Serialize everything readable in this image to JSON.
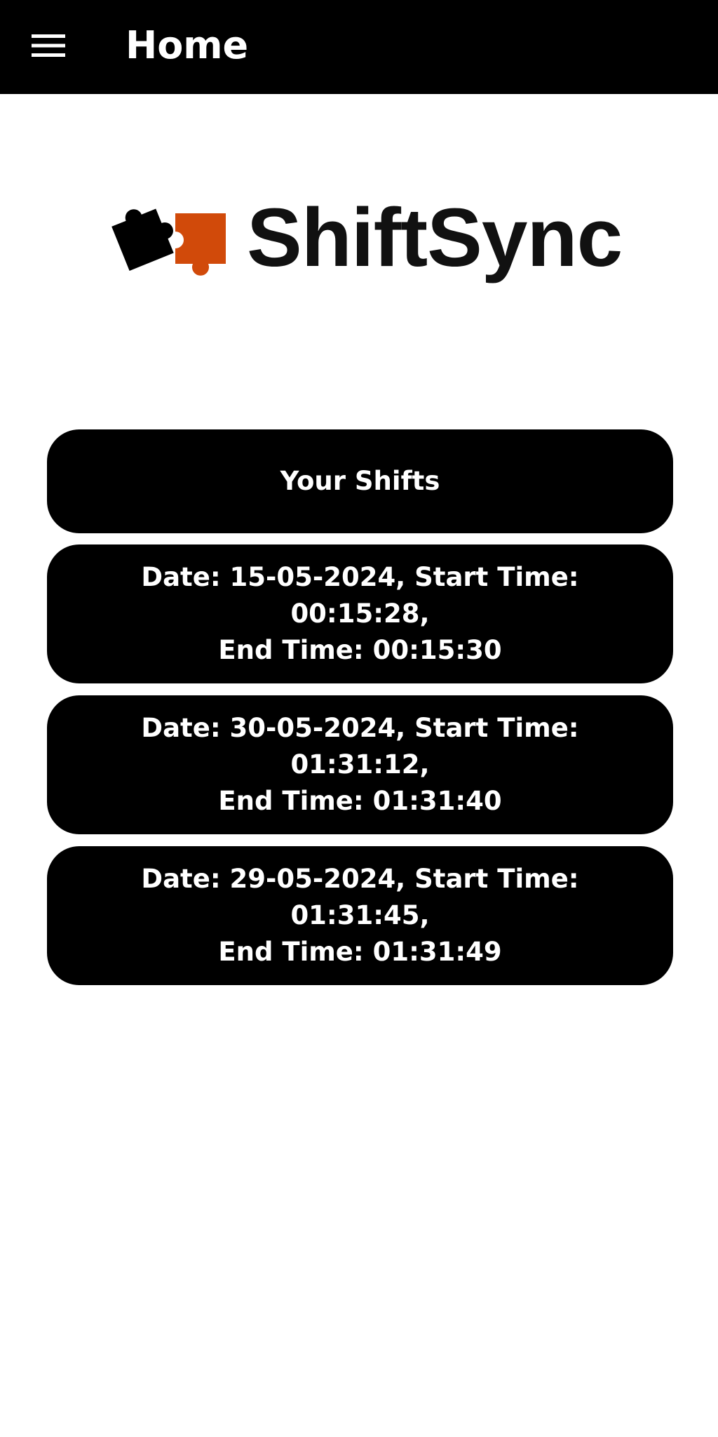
{
  "app_bar": {
    "title": "Home",
    "menu_icon": "menu-icon"
  },
  "logo": {
    "text": "ShiftSync",
    "icon": "puzzle-pieces-icon",
    "colors": {
      "dark_piece": "#000000",
      "accent_piece": "#D14A0A"
    }
  },
  "shifts": {
    "header_label": "Your Shifts",
    "items": [
      {
        "line1": "Date: 15-05-2024, Start Time: 00:15:28,",
        "line2": "End Time: 00:15:30"
      },
      {
        "line1": "Date: 30-05-2024, Start Time: 01:31:12,",
        "line2": "End Time: 01:31:40"
      },
      {
        "line1": "Date: 29-05-2024, Start Time: 01:31:45,",
        "line2": "End Time: 01:31:49"
      }
    ]
  }
}
